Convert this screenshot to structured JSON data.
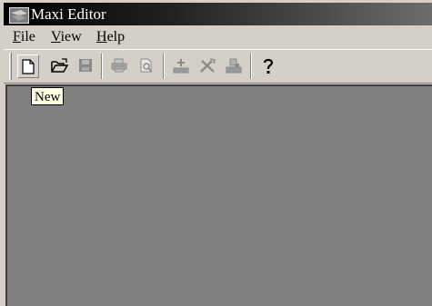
{
  "window": {
    "title": "Maxi Editor"
  },
  "menu": [
    {
      "accel": "F",
      "rest": "ile"
    },
    {
      "accel": "V",
      "rest": "iew"
    },
    {
      "accel": "H",
      "rest": "elp"
    }
  ],
  "toolbar": {
    "buttons": [
      {
        "icon": "new-document-icon",
        "enabled": true
      },
      {
        "icon": "open-folder-icon",
        "enabled": true
      },
      {
        "icon": "save-icon",
        "enabled": false
      },
      {
        "icon": "print-icon",
        "enabled": false
      },
      {
        "icon": "print-preview-icon",
        "enabled": false
      },
      {
        "icon": "add-icon",
        "enabled": false
      },
      {
        "icon": "tools-icon",
        "enabled": false
      },
      {
        "icon": "import-icon",
        "enabled": false
      },
      {
        "icon": "help-icon",
        "enabled": true
      }
    ]
  },
  "tooltip": {
    "text": "New"
  },
  "colors": {
    "face": "#d4d0c8",
    "client": "#808080",
    "tooltip_bg": "#ffffe1",
    "disabled_icon": "#8a8a8a"
  }
}
